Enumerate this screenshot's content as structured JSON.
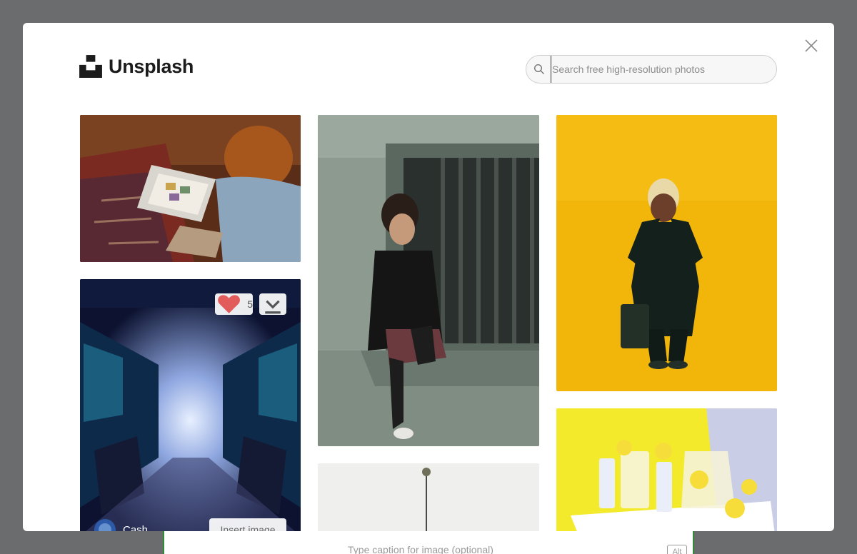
{
  "brand": {
    "name": "Unsplash"
  },
  "search": {
    "placeholder": "Search free high-resolution photos"
  },
  "photo_card": {
    "likes": "5",
    "author": "Cash",
    "insert_label": "Insert image"
  },
  "editor": {
    "caption_placeholder": "Type caption for image (optional)",
    "alt_label": "Alt"
  },
  "icons": {
    "close": "close-icon",
    "search": "search-icon",
    "like": "heart-icon",
    "download": "download-icon"
  },
  "colors": {
    "accent_heart": "#e25c5c",
    "editor_border": "#2f8a3a"
  }
}
